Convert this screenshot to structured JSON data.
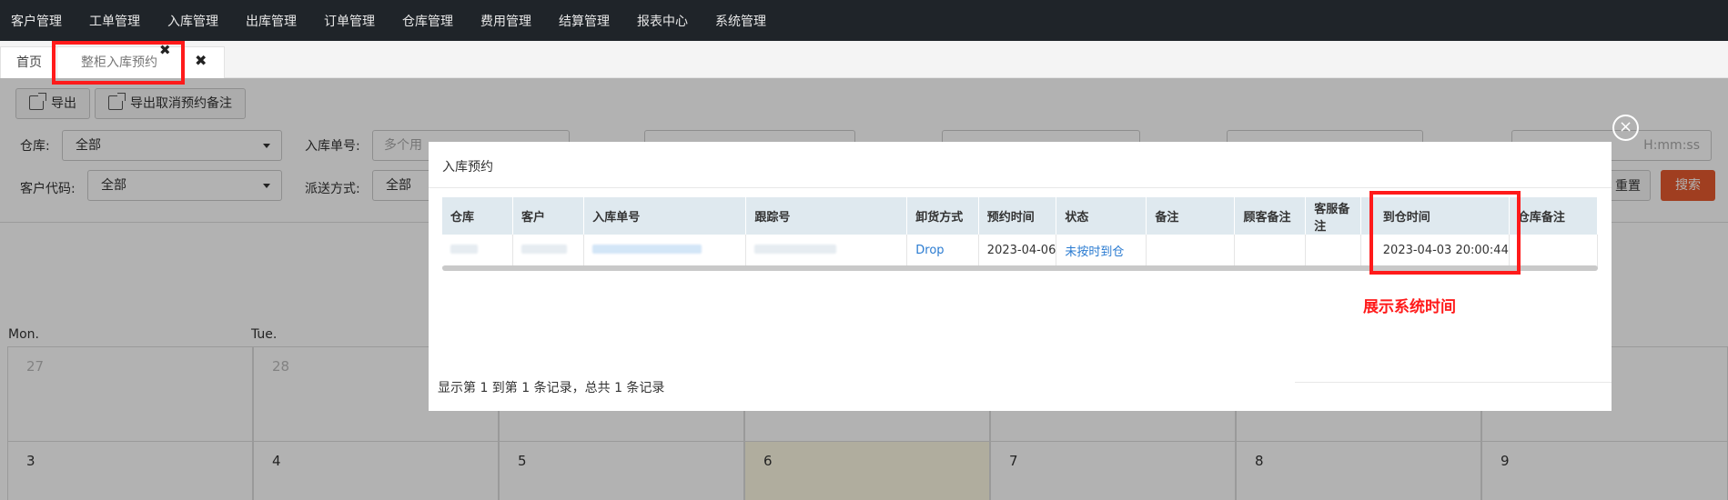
{
  "nav": [
    "客户管理",
    "工单管理",
    "入库管理",
    "出库管理",
    "订单管理",
    "仓库管理",
    "费用管理",
    "结算管理",
    "报表中心",
    "系统管理"
  ],
  "tabs": {
    "home": "首页",
    "active": "整柜入库预约",
    "close_glyph": "✖"
  },
  "toolbar": {
    "export": "导出",
    "export_cancel": "导出取消预约备注"
  },
  "filters": {
    "warehouse_label": "仓库:",
    "warehouse_value": "全部",
    "inbound_no_label": "入库单号:",
    "inbound_no_placeholder": "多个用",
    "customer_code_label": "客户代码:",
    "customer_code_value": "全部",
    "delivery_label": "派送方式:",
    "delivery_value": "全部",
    "time_placeholder": "H:mm:ss"
  },
  "buttons": {
    "reset": "重置",
    "search": "搜索"
  },
  "calendar": {
    "day_headers": [
      "Mon.",
      "Tue."
    ],
    "row1": [
      "27",
      "28"
    ],
    "row2": [
      "3",
      "4",
      "5",
      "6",
      "7",
      "8",
      "9"
    ]
  },
  "modal": {
    "title": "入库预约",
    "close_glyph": "×",
    "columns": [
      "仓库",
      "客户",
      "入库单号",
      "跟踪号",
      "卸货方式",
      "预约时间",
      "状态",
      "备注",
      "顾客备注",
      "客服备注",
      "到仓时间",
      "仓库备注"
    ],
    "row": {
      "unload": "Drop",
      "appointment_time": "2023-04-06",
      "status": "未按时到仓",
      "arrival_time": "2023-04-03 20:00:44"
    },
    "footer": "显示第 1 到第 1 条记录，总共 1 条记录"
  },
  "annotation": {
    "label": "展示系统时间",
    "color": "#ff1a1a"
  }
}
